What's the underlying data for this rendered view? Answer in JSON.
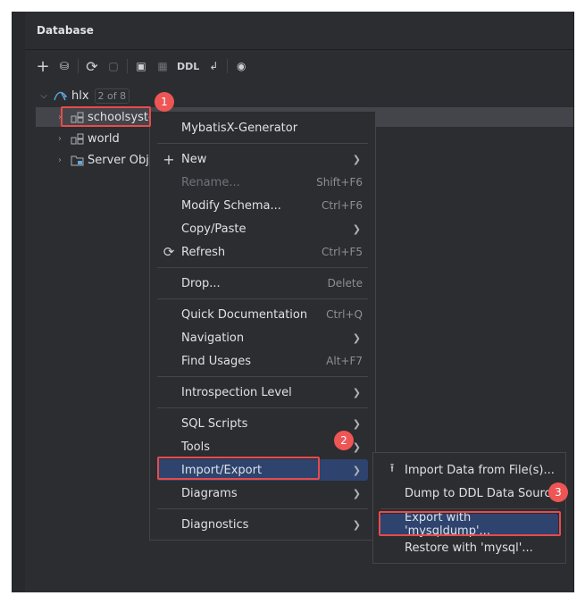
{
  "panel": {
    "title": "Database",
    "toolbar": [
      {
        "name": "add-icon",
        "glyph": "+"
      },
      {
        "name": "datasource-properties-icon",
        "glyph": "⛁"
      },
      {
        "name": "refresh-icon",
        "glyph": "⟳"
      },
      {
        "name": "jump-to-query-console-icon",
        "glyph": "▢"
      },
      {
        "name": "open-console-icon",
        "glyph": "▣"
      },
      {
        "name": "table-editor-icon",
        "glyph": "▦"
      },
      {
        "name": "ddl-button",
        "label": "DDL"
      },
      {
        "name": "jump-to-source-icon",
        "glyph": "↲"
      },
      {
        "name": "view-options-icon",
        "glyph": "◉"
      }
    ]
  },
  "tree": {
    "root": {
      "label": "hlx",
      "counter": "2 of 8"
    },
    "items": [
      {
        "label": "schoolsyste"
      },
      {
        "label": "world"
      },
      {
        "label": "Server Obje"
      }
    ]
  },
  "context_menu": {
    "items": [
      {
        "label": "MybatisX-Generator"
      },
      {
        "label": "New",
        "icon": "+"
      },
      {
        "label": "Rename...",
        "shortcut": "Shift+F6"
      },
      {
        "label": "Modify Schema...",
        "shortcut": "Ctrl+F6"
      },
      {
        "label": "Copy/Paste"
      },
      {
        "label": "Refresh",
        "shortcut": "Ctrl+F5",
        "icon": "⟳"
      },
      {
        "label": "Drop...",
        "shortcut": "Delete"
      },
      {
        "label": "Quick Documentation",
        "shortcut": "Ctrl+Q"
      },
      {
        "label": "Navigation"
      },
      {
        "label": "Find Usages",
        "shortcut": "Alt+F7"
      },
      {
        "label": "Introspection Level"
      },
      {
        "label": "SQL Scripts"
      },
      {
        "label": "Tools"
      },
      {
        "label": "Import/Export"
      },
      {
        "label": "Diagrams"
      },
      {
        "label": "Diagnostics"
      }
    ]
  },
  "submenu": {
    "items": [
      {
        "label": "Import Data from File(s)...",
        "icon": "⭱"
      },
      {
        "label": "Dump to DDL Data Source"
      },
      {
        "label": "Export with 'mysqldump'..."
      },
      {
        "label": "Restore with 'mysql'..."
      }
    ]
  },
  "callouts": [
    "1",
    "2",
    "3"
  ],
  "colors": {
    "highlight": "#2e436e",
    "callout": "#ee5555",
    "panel_bg": "#2b2d30"
  }
}
